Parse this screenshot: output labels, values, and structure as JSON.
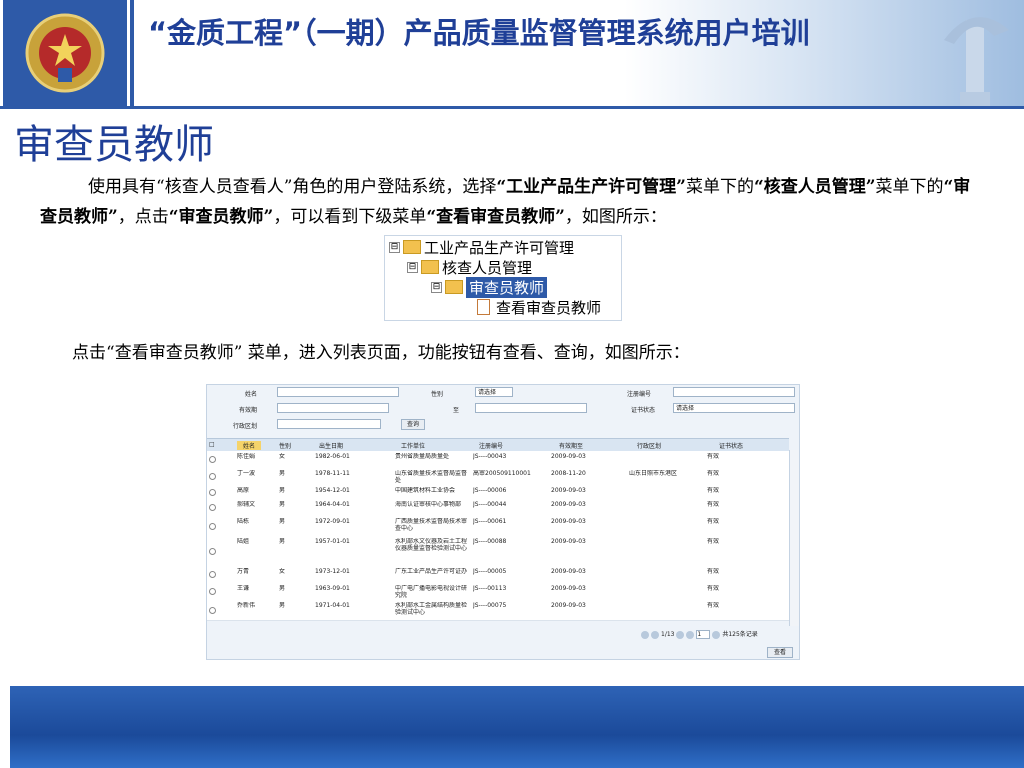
{
  "header": {
    "title": "“金质工程”（一期）产品质量监督管理系统用户培训",
    "logo_icon": "national-emblem-icon",
    "pillar_icon": "huabiao-pillar-icon",
    "colors": {
      "accent": "#2e5aa8",
      "title": "#1f3f97"
    }
  },
  "page_title": "审查员教师",
  "para1": {
    "t1": "使用具有“核查人员查看人”角色的用户登陆系统，选择",
    "b1": "“工业产品生产许可管理”",
    "t2": "菜单下的",
    "b2": "“核查人员管理”",
    "t3": "菜单下的",
    "b3": "“审查员教师”",
    "t4": "，点击",
    "b4": "“审查员教师”",
    "t5": "，可以看到下级菜单",
    "b5": "“查看审查员教师”",
    "t6": "，如图所示："
  },
  "tree": {
    "items": [
      "工业产品生产许可管理",
      "核查人员管理",
      "审查员教师",
      "查看审查员教师"
    ],
    "expand_marks": [
      "⊟",
      "⊟",
      "⊟"
    ]
  },
  "para2": "点击“查看审查员教师”  菜单，进入列表页面，功能按钮有查看、查询，如图所示：",
  "grid": {
    "query": {
      "name_label": "姓名",
      "gender_label": "性别",
      "gender_value": "请选择",
      "reg_label": "注册编号",
      "valid_label": "有效期",
      "to_label": "至",
      "cert_label": "证书状态",
      "cert_value": "请选择",
      "region_label": "行政区划",
      "search_button": "查询"
    },
    "columns": [
      "姓名",
      "性别",
      "出生日期",
      "工作单位",
      "注册编号",
      "有效期至",
      "行政区划",
      "证书状态"
    ],
    "rows": [
      [
        "陈佳娟",
        "女",
        "1982-06-01",
        "贵州省质量局质量处",
        "JS----00043",
        "2009-09-03",
        "",
        "有效"
      ],
      [
        "丁一波",
        "男",
        "1978-11-11",
        "山东省质量技术监督局监督处",
        "高审200509110001",
        "2008-11-20",
        "山东日照市东港区",
        "有效"
      ],
      [
        "高原",
        "男",
        "1954-12-01",
        "中国建筑材料工业协会",
        "JS----00006",
        "2009-09-03",
        "",
        "有效"
      ],
      [
        "郝辅文",
        "男",
        "1964-04-01",
        "海南认证审核中心事物部",
        "JS----00044",
        "2009-09-03",
        "",
        "有效"
      ],
      [
        "陆栋",
        "男",
        "1972-09-01",
        "广西质量技术监督局技术审查中心",
        "JS----00061",
        "2009-09-03",
        "",
        "有效"
      ],
      [
        "陆姐",
        "男",
        "1957-01-01",
        "水利部水文仪器及岩土工程仪器质量监督检验测试中心",
        "JS----00088",
        "2009-09-03",
        "",
        "有效"
      ],
      [
        "万青",
        "女",
        "1973-12-01",
        "广东工业产品生产许可证办",
        "JS----00005",
        "2009-09-03",
        "",
        "有效"
      ],
      [
        "王谦",
        "男",
        "1963-09-01",
        "中广电广播电影电视设计研究院",
        "JS----00113",
        "2009-09-03",
        "",
        "有效"
      ],
      [
        "乔新伟",
        "男",
        "1971-04-01",
        "水利部水工金属结构质量检验测试中心",
        "JS----00075",
        "2009-09-03",
        "",
        "有效"
      ]
    ],
    "pager": {
      "page": "1/13",
      "page_input": "1",
      "total": "共125条记录"
    },
    "view_button": "查看"
  }
}
